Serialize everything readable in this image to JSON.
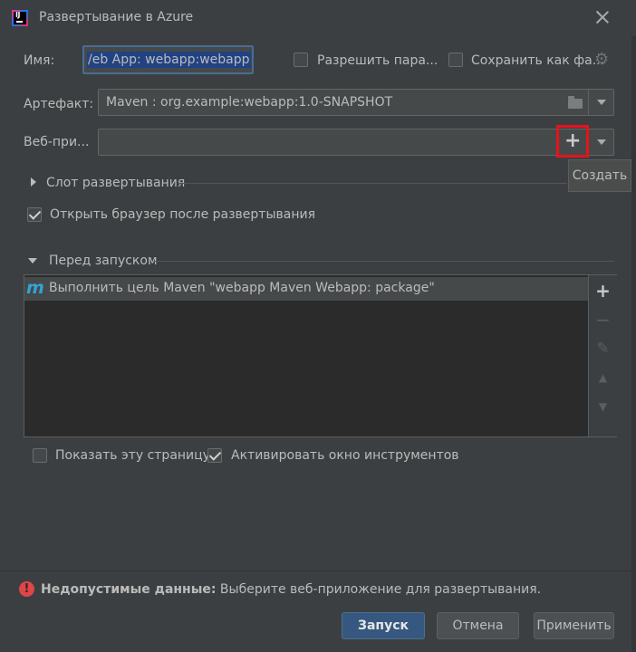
{
  "window": {
    "app_icon_text": "IJ",
    "title": "Развертывание в Azure"
  },
  "form": {
    "name_label": "Имя:",
    "name_value": "Web App: webapp:webapp",
    "name_value_visible": "/eb App: webapp:webapp",
    "allow_parallel_label": "Разрешить пара...",
    "allow_parallel_checked": false,
    "save_as_file_label": "Сохранить как фа...",
    "save_as_file_checked": false,
    "artifact_label": "Артефакт:",
    "artifact_value": "Maven : org.example:webapp:1.0-SNAPSHOT",
    "webapp_label": "Веб-при...",
    "webapp_value": "",
    "create_tooltip": "Создать"
  },
  "sections": {
    "slot_label": "Слот развертывания",
    "slot_expanded": false,
    "open_browser_label": "Открыть браузер после развертывания",
    "open_browser_checked": true,
    "before_launch_label": "Перед запуском",
    "before_launch_expanded": true
  },
  "before_launch_tasks": [
    {
      "icon": "maven-icon",
      "glyph": "m",
      "label": "Выполнить цель Maven \"webapp Maven Webapp: package\""
    }
  ],
  "task_tools": [
    {
      "name": "add-task-button",
      "glyph": "+",
      "enabled": true
    },
    {
      "name": "remove-task-button",
      "glyph": "−",
      "enabled": false
    },
    {
      "name": "edit-task-button",
      "glyph": "✎",
      "enabled": false
    },
    {
      "name": "move-up-button",
      "glyph": "▲",
      "enabled": false
    },
    {
      "name": "move-down-button",
      "glyph": "▼",
      "enabled": false
    }
  ],
  "options": {
    "show_page_label": "Показать эту страницу",
    "show_page_checked": false,
    "activate_tool_window_label": "Активировать окно инструментов",
    "activate_tool_window_checked": true
  },
  "validation": {
    "title": "Недопустимые данные:",
    "message": " Выберите веб-приложение для развертывания.",
    "icon": "error-icon",
    "icon_glyph": "!"
  },
  "buttons": {
    "run": "Запуск",
    "cancel": "Отмена",
    "apply": "Применить"
  },
  "colors": {
    "background": "#3c3f41",
    "primary_button": "#365880",
    "error": "#e0454a",
    "highlight_box": "#e8121b",
    "maven_icon": "#33a3d8"
  }
}
